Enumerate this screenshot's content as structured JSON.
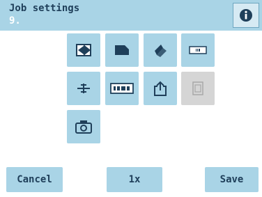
{
  "header": {
    "title": "Job settings",
    "subtitle": "9.",
    "info_icon": "info-icon"
  },
  "grid": [
    {
      "name": "double-feed-icon",
      "enabled": true
    },
    {
      "name": "envelope-icon",
      "enabled": true
    },
    {
      "name": "fold-icon",
      "enabled": true
    },
    {
      "name": "barcode-reading-icon",
      "enabled": true
    },
    {
      "name": "separation-icon",
      "enabled": true
    },
    {
      "name": "name-label-icon",
      "enabled": true
    },
    {
      "name": "export-icon",
      "enabled": true
    },
    {
      "name": "insert-icon",
      "enabled": false
    },
    {
      "name": "camera-icon",
      "enabled": true
    }
  ],
  "footer": {
    "cancel_label": "Cancel",
    "count_label": "1x",
    "save_label": "Save"
  },
  "colors": {
    "accent": "#a9d4e6",
    "text": "#1f3f5a",
    "disabled": "#d5d5d5"
  }
}
